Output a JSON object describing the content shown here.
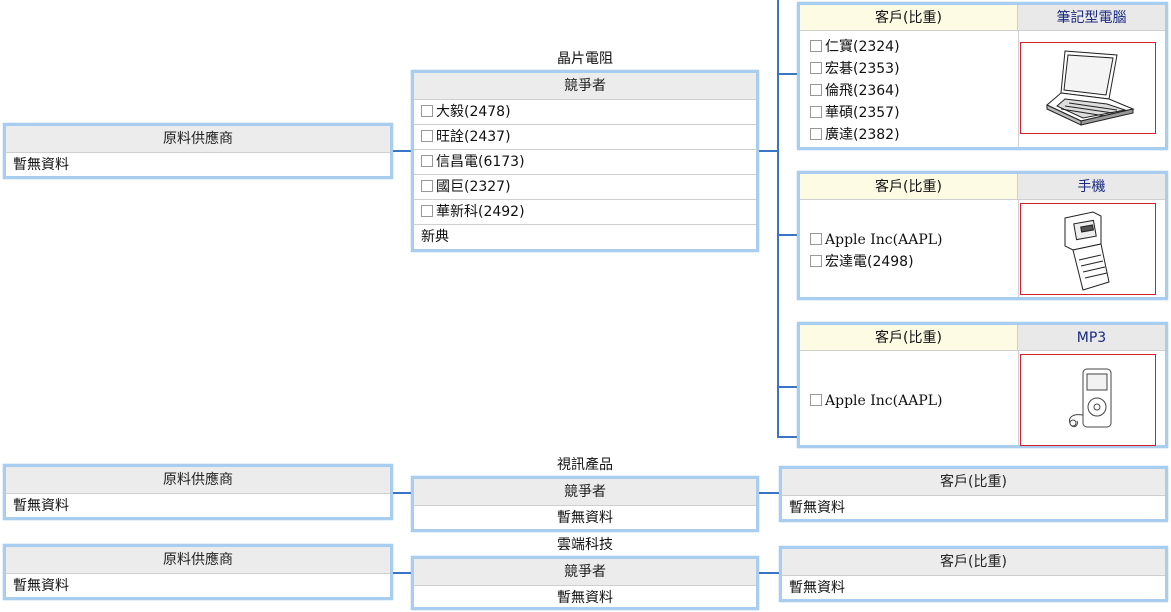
{
  "supplier_header": "原料供應商",
  "competitor_header": "競爭者",
  "customer_header": "客戶(比重)",
  "no_data": "暫無資料",
  "sections": [
    {
      "title": "晶片電阻",
      "competitors": [
        "大毅(2478)",
        "旺詮(2437)",
        "信昌電(6173)",
        "國巨(2327)",
        "華新科(2492)"
      ],
      "competitor_footer": "新典",
      "customer_groups": [
        {
          "product": "筆記型電腦",
          "image": "laptop-icon",
          "customers": [
            "仁寶(2324)",
            "宏碁(2353)",
            "倫飛(2364)",
            "華碩(2357)",
            "廣達(2382)"
          ]
        },
        {
          "product": "手機",
          "image": "phone-icon",
          "customers": [
            "Apple Inc(AAPL)",
            "宏達電(2498)"
          ]
        },
        {
          "product": "MP3",
          "image": "mp3-player-icon",
          "customers": [
            "Apple Inc(AAPL)"
          ]
        }
      ]
    },
    {
      "title": "視訊產品"
    },
    {
      "title": "雲端科技"
    }
  ]
}
